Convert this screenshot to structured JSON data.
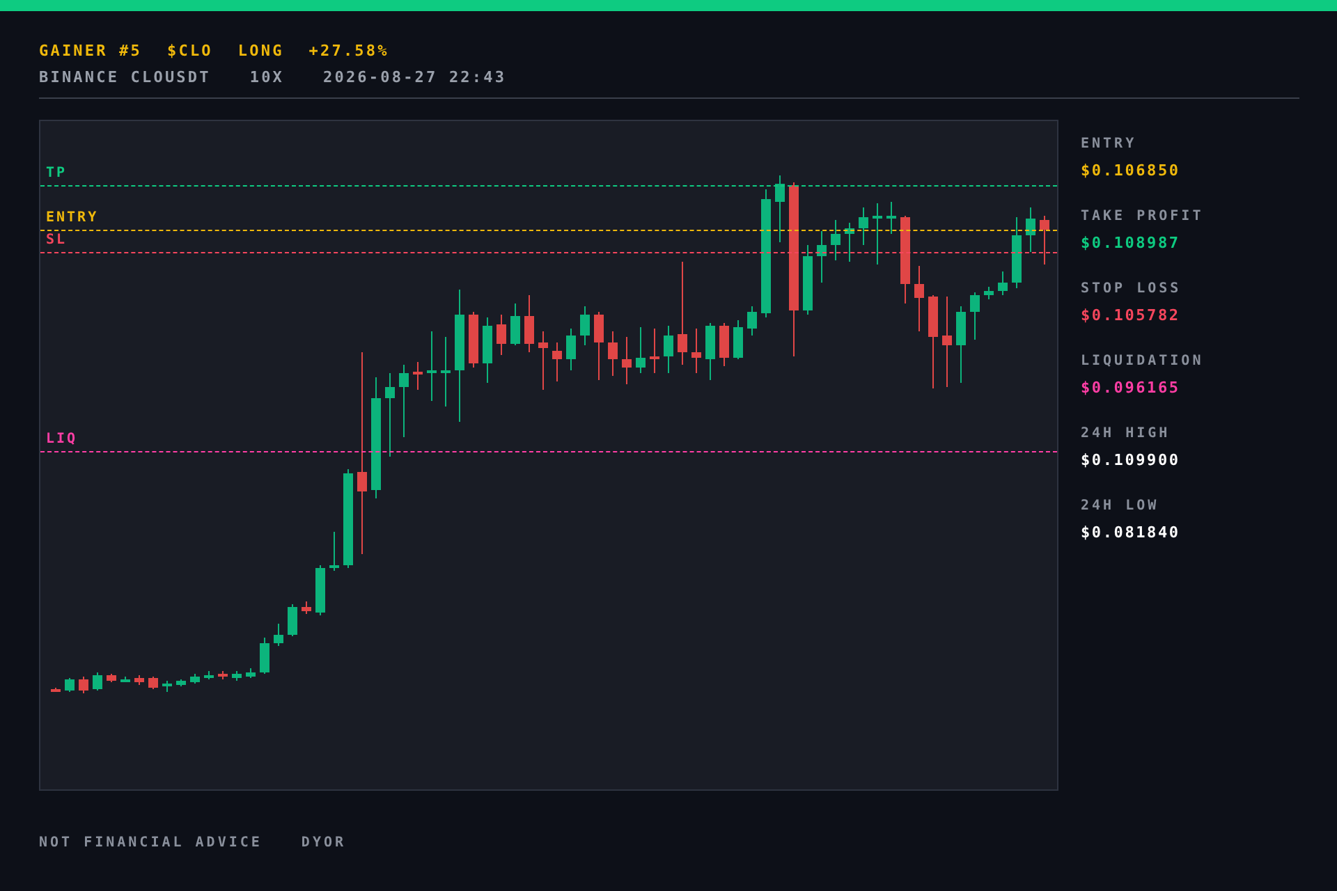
{
  "header": {
    "title_parts": [
      "GAINER #5",
      "$CLO",
      "LONG",
      "+27.58%"
    ],
    "meta_parts": [
      "BINANCE CLOUSDT",
      "10X",
      "2026-08-27 22:43"
    ]
  },
  "chart": {
    "price_lines": [
      {
        "kind": "tp",
        "label": "TP",
        "color": "#0ecb81"
      },
      {
        "kind": "entry",
        "label": "ENTRY",
        "color": "#f0b90b"
      },
      {
        "kind": "sl",
        "label": "SL",
        "color": "#f6465d"
      },
      {
        "kind": "liq",
        "label": "LIQ",
        "color": "#ff3ea5"
      }
    ]
  },
  "stats": [
    {
      "kind": "entry",
      "label": "ENTRY",
      "value": "$0.106850",
      "color": "#f0b90b"
    },
    {
      "kind": "tp",
      "label": "TAKE PROFIT",
      "value": "$0.108987",
      "color": "#0ecb81"
    },
    {
      "kind": "sl",
      "label": "STOP LOSS",
      "value": "$0.105782",
      "color": "#f6465d"
    },
    {
      "kind": "liq",
      "label": "LIQUIDATION",
      "value": "$0.096165",
      "color": "#ff3ea5"
    },
    {
      "label": "24H HIGH",
      "value": "$0.109900",
      "color": "#ffffff"
    },
    {
      "label": "24H LOW",
      "value": "$0.081840",
      "color": "#ffffff"
    }
  ],
  "footer": [
    "NOT FINANCIAL ADVICE",
    "DYOR"
  ]
}
